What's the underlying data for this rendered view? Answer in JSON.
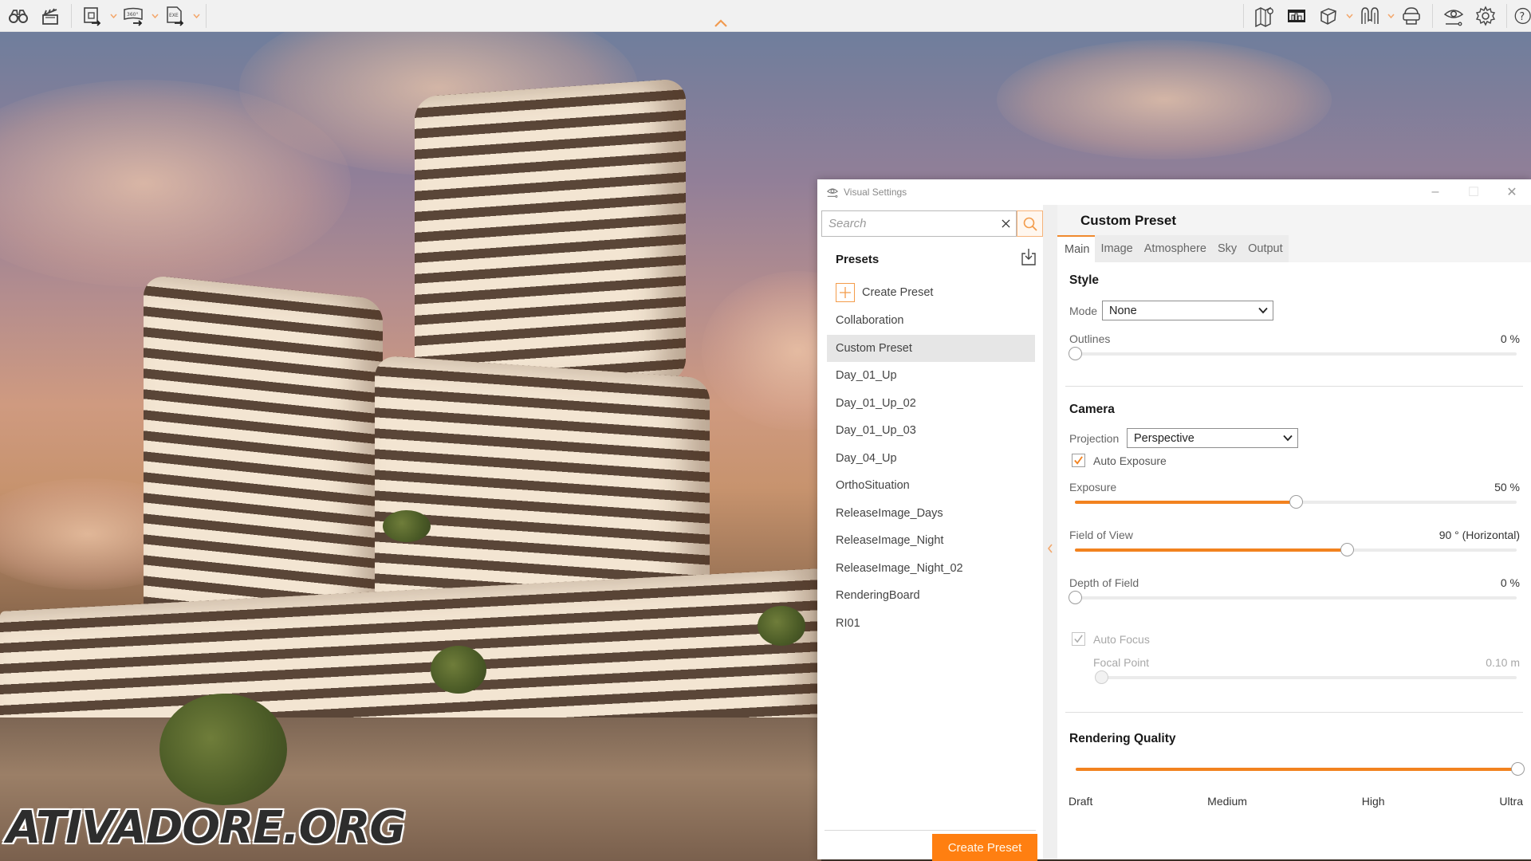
{
  "toolbar": {
    "left_buttons": [
      {
        "name": "binoculars-icon",
        "label": "Walkthrough"
      },
      {
        "name": "clapperboard-icon",
        "label": "Video"
      }
    ],
    "export_buttons": [
      {
        "name": "export-image-icon",
        "has_dropdown": true
      },
      {
        "name": "export-360-icon",
        "glyph_text": "360°",
        "has_dropdown": true
      },
      {
        "name": "export-exe-icon",
        "glyph_text": "EXE",
        "has_dropdown": true
      }
    ],
    "right_buttons": [
      {
        "name": "map-pin-icon"
      },
      {
        "name": "cityscape-icon"
      },
      {
        "name": "cube-icon",
        "has_dropdown": true
      },
      {
        "name": "bridge-icon",
        "has_dropdown": true
      },
      {
        "name": "vr-headset-icon"
      },
      {
        "name": "visual-settings-eye-icon"
      },
      {
        "name": "gear-icon"
      },
      {
        "name": "help-icon",
        "glyph_text": "?"
      }
    ]
  },
  "watermark": "ATIVADORE.ORG",
  "panel": {
    "title": "Visual Settings",
    "controls": {
      "minimize": "–",
      "maximize": "☐",
      "close": "✕"
    },
    "search": {
      "placeholder": "Search",
      "value": ""
    },
    "presets_header": "Presets",
    "create_preset_item": "Create Preset",
    "presets": [
      {
        "label": "Collaboration",
        "selected": false
      },
      {
        "label": "Custom Preset",
        "selected": true
      },
      {
        "label": "Day_01_Up",
        "selected": false
      },
      {
        "label": "Day_01_Up_02",
        "selected": false
      },
      {
        "label": "Day_01_Up_03",
        "selected": false
      },
      {
        "label": "Day_04_Up",
        "selected": false
      },
      {
        "label": "OrthoSituation",
        "selected": false
      },
      {
        "label": "ReleaseImage_Days",
        "selected": false
      },
      {
        "label": "ReleaseImage_Night",
        "selected": false
      },
      {
        "label": "ReleaseImage_Night_02",
        "selected": false
      },
      {
        "label": "RenderingBoard",
        "selected": false
      },
      {
        "label": "RI01",
        "selected": false
      }
    ],
    "create_preset_button": "Create Preset",
    "detail": {
      "title": "Custom Preset",
      "tabs": [
        {
          "label": "Main",
          "active": true
        },
        {
          "label": "Image",
          "active": false
        },
        {
          "label": "Atmosphere",
          "active": false
        },
        {
          "label": "Sky",
          "active": false
        },
        {
          "label": "Output",
          "active": false
        }
      ],
      "style": {
        "title": "Style",
        "mode_label": "Mode",
        "mode_value": "None",
        "outlines_label": "Outlines",
        "outlines_value": "0 %",
        "outlines_fraction": 0.0
      },
      "camera": {
        "title": "Camera",
        "projection_label": "Projection",
        "projection_value": "Perspective",
        "auto_exposure_label": "Auto Exposure",
        "auto_exposure_checked": true,
        "exposure_label": "Exposure",
        "exposure_value": "50 %",
        "exposure_fraction": 0.5,
        "fov_label": "Field of View",
        "fov_value": "90 ° (Horizontal)",
        "fov_fraction": 0.616,
        "dof_label": "Depth of Field",
        "dof_value": "0 %",
        "dof_fraction": 0.0,
        "auto_focus_label": "Auto Focus",
        "auto_focus_checked": true,
        "auto_focus_disabled": true,
        "focal_point_label": "Focal Point",
        "focal_point_value": "0.10  m",
        "focal_point_fraction": 0.0
      },
      "rendering_quality": {
        "title": "Rendering Quality",
        "levels": [
          "Draft",
          "Medium",
          "High",
          "Ultra"
        ],
        "selected": "Ultra",
        "fraction": 1.0
      }
    }
  },
  "colors": {
    "accent": "#f2821f",
    "button_orange": "#ff7f11",
    "selected_row": "#e6e6e6"
  }
}
